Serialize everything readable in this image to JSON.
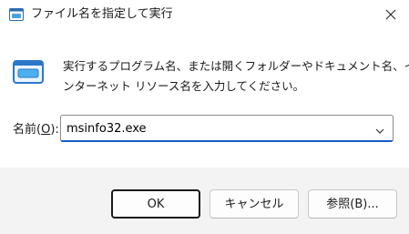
{
  "window": {
    "title": "ファイル名を指定して実行",
    "close_glyph": "✕"
  },
  "icons": {
    "title": "run-app-icon",
    "dialog": "run-dialog-icon",
    "close": "close-icon",
    "dropdown": "chevron-down-icon"
  },
  "description": {
    "line1": "実行するプログラム名、または開くフォルダーやドキュメント名、イ",
    "line2": "ンターネット リソース名を入力してください。"
  },
  "open_field": {
    "label_prefix": "名前(",
    "label_mnemonic": "O",
    "label_suffix": "):",
    "value": "msinfo32.exe"
  },
  "buttons": {
    "ok": "OK",
    "cancel": "キャンセル",
    "browse": "参照(B)..."
  },
  "colors": {
    "accent": "#0f5fc2",
    "footer_bg": "#f3f3f3"
  }
}
